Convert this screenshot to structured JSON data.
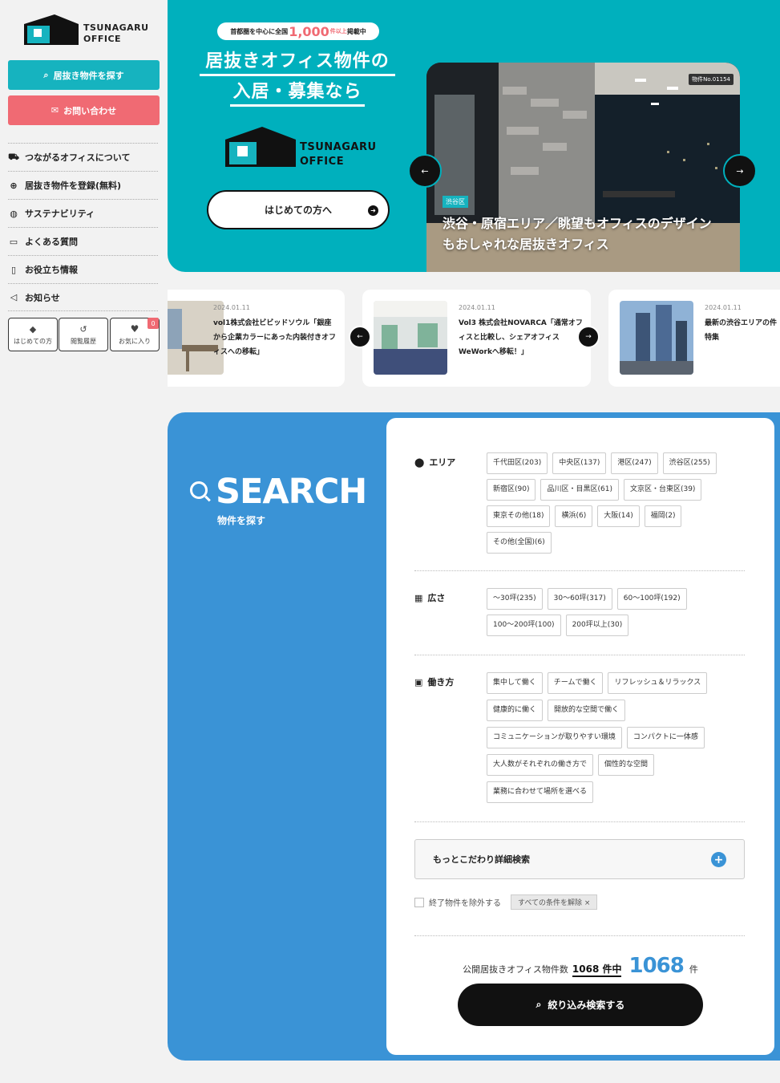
{
  "brand": {
    "line1": "TSUNAGARU",
    "line2": "OFFICE"
  },
  "sidebar": {
    "search_button": "居抜き物件を探す",
    "contact_button": "お問い合わせ",
    "nav": [
      {
        "label": "つながるオフィスについて",
        "icon": "truck-icon"
      },
      {
        "label": "居抜き物件を登録(無料)",
        "icon": "plus-circle-icon"
      },
      {
        "label": "サステナビリティ",
        "icon": "globe-icon"
      },
      {
        "label": "よくある質問",
        "icon": "chat-icon"
      },
      {
        "label": "お役立ち情報",
        "icon": "document-search-icon"
      },
      {
        "label": "お知らせ",
        "icon": "megaphone-icon"
      }
    ],
    "quick": [
      {
        "label": "はじめての方",
        "icon": "beginner-icon"
      },
      {
        "label": "閲覧履歴",
        "icon": "history-icon"
      },
      {
        "label": "お気に入り",
        "icon": "heart-icon"
      }
    ],
    "favorite_count": "0"
  },
  "hero": {
    "pill_pre": "首都圏を中心に全国",
    "pill_num": "1,000",
    "pill_unit": "件以上",
    "pill_post": "掲載中",
    "title1": "居抜きオフィス物件の",
    "title2": "入居・募集なら",
    "first_button": "はじめての方へ",
    "property_no": "物件No.01154",
    "area_tag": "渋谷区",
    "caption": "渋谷・原宿エリア／眺望もオフィスのデザインもおしゃれな居抜きオフィス"
  },
  "news": [
    {
      "date": "2024.01.11",
      "title": "vol1株式会社ビビッドソウル「銀座から企業カラーにあった内装付きオフィスへの移転」"
    },
    {
      "date": "2024.01.11",
      "title": "Vol3 株式会社NOVARCA「通常オフィスと比較し、シェアオフィスWeWorkへ移転！」"
    },
    {
      "date": "2024.01.11",
      "title": "最新の渋谷エリアの件特集"
    }
  ],
  "search": {
    "title": "SEARCH",
    "subtitle": "物件を探す",
    "area_label": "エリア",
    "areas": [
      "千代田区(203)",
      "中央区(137)",
      "港区(247)",
      "渋谷区(255)",
      "新宿区(90)",
      "品川区・目黒区(61)",
      "文京区・台東区(39)",
      "東京その他(18)",
      "横浜(6)",
      "大阪(14)",
      "福岡(2)",
      "その他(全国)(6)"
    ],
    "size_label": "広さ",
    "sizes": [
      "〜30坪(235)",
      "30〜60坪(317)",
      "60〜100坪(192)",
      "100〜200坪(100)",
      "200坪以上(30)"
    ],
    "style_label": "働き方",
    "styles": [
      "集中して働く",
      "チームで働く",
      "リフレッシュ＆リラックス",
      "健康的に働く",
      "開放的な空間で働く",
      "コミュニケーションが取りやすい環境",
      "コンパクトに一体感",
      "大人数がそれぞれの働き方で",
      "個性的な空間",
      "業務に合わせて場所を選べる"
    ],
    "more": "もっとこだわり詳細検索",
    "exclude": "終了物件を除外する",
    "clear": "すべての条件を解除",
    "count_pre": "公開居抜きオフィス物件数",
    "count_total": "1068 件中",
    "count_hit": "1068",
    "count_unit": "件",
    "submit": "絞り込み検索する"
  },
  "colors": {
    "teal": "#00b0bd",
    "pink": "#f06a73",
    "blue": "#3a93d6"
  }
}
